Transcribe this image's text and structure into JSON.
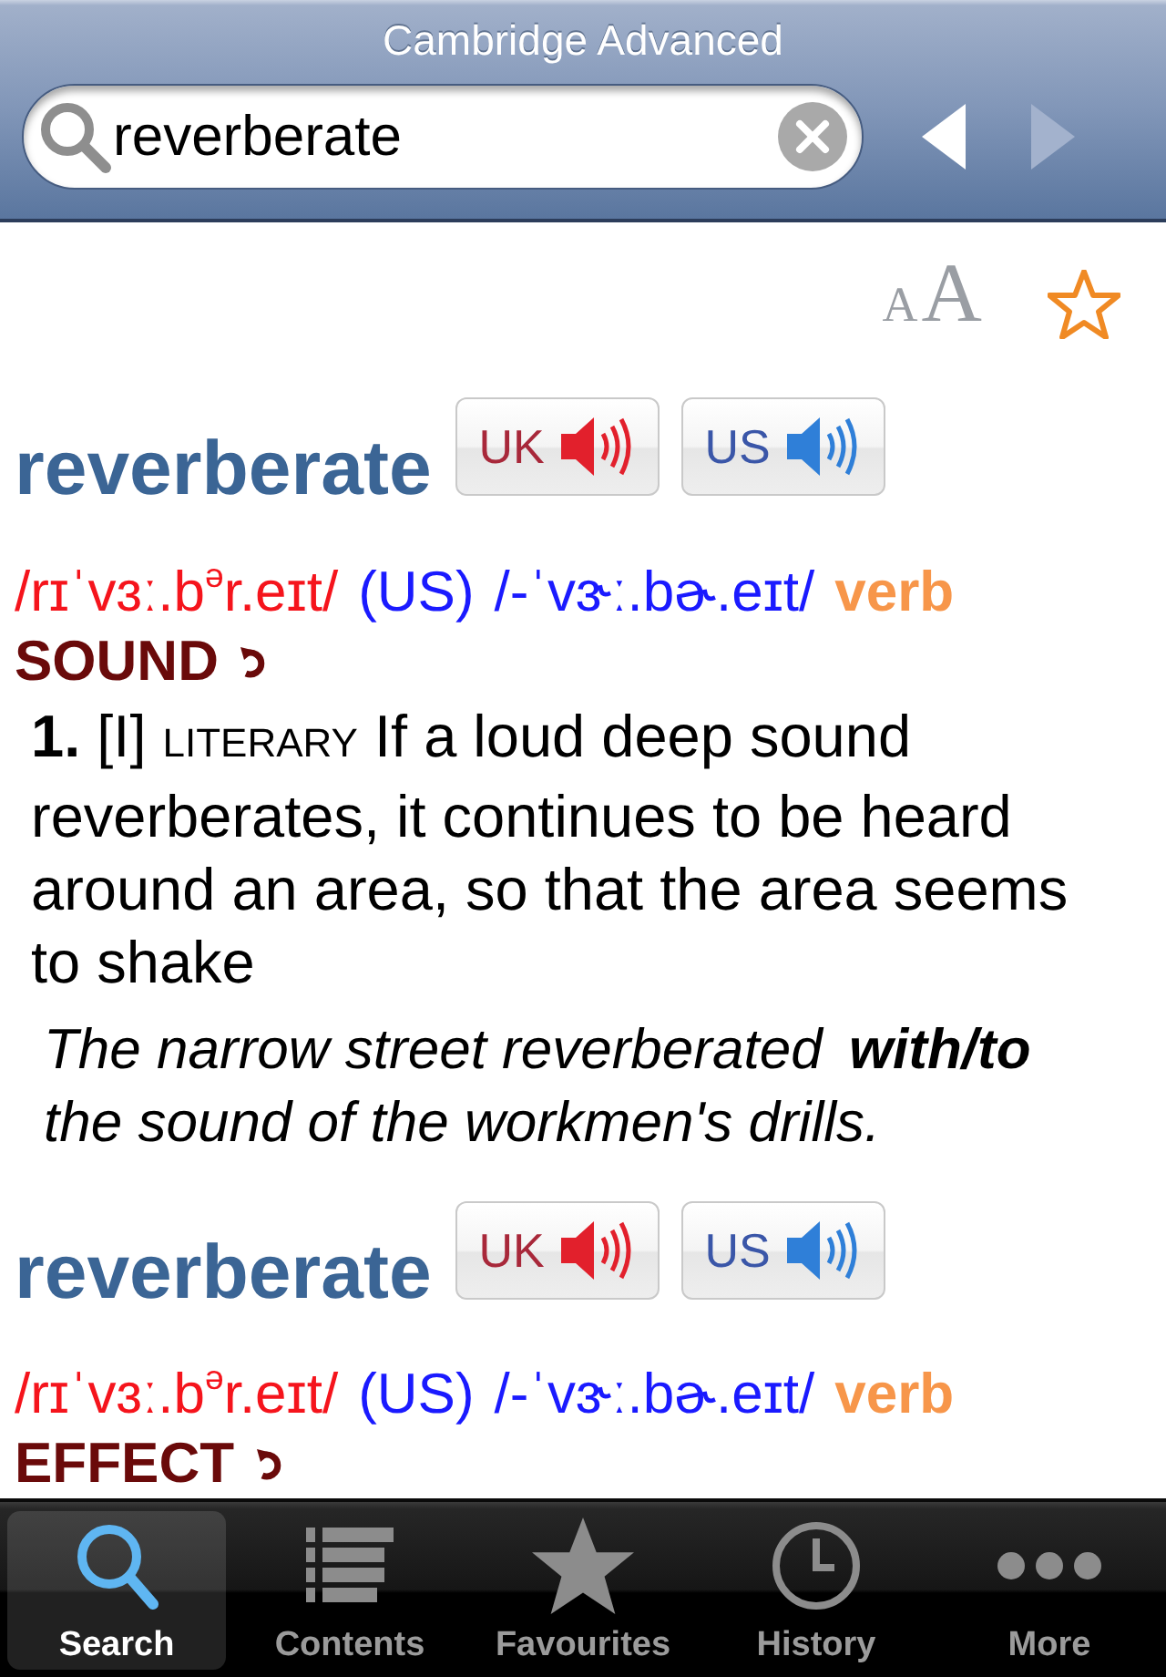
{
  "header": {
    "title": "Cambridge Advanced"
  },
  "search": {
    "value": "reverberate"
  },
  "nav": [
    {
      "kind": "back",
      "disabled": false
    },
    {
      "kind": "forward",
      "disabled": true
    }
  ],
  "toolbar": {
    "text_size": [
      "A",
      "A"
    ],
    "starred": false
  },
  "entries": [
    {
      "headword": "reverberate",
      "audio": [
        {
          "kind": "uk",
          "label": "UK"
        },
        {
          "kind": "us",
          "label": "US"
        }
      ],
      "pron_uk": "/rɪˈvɜː.b$^{ə}$r.eɪt/",
      "region": "(US)",
      "pron_us": "/-ˈvɝː.bɚ.eɪt/",
      "pos": "verb",
      "guide": "SOUND",
      "senses": [
        {
          "number": "1.",
          "grammar": "[I]",
          "register": "LITERARY",
          "definition": "If a loud deep sound reverberates, it continues to be heard around an area, so that the area seems to shake",
          "examples": [
            "The narrow street reverberated **with/to** the sound of the workmen's drills."
          ]
        }
      ]
    },
    {
      "headword": "reverberate",
      "audio": [
        {
          "kind": "uk",
          "label": "UK"
        },
        {
          "kind": "us",
          "label": "US"
        }
      ],
      "pron_uk": "/rɪˈvɜː.b$^{ə}$r.eɪt/",
      "region": "(US)",
      "pron_us": "/-ˈvɝː.bɚ.eɪt/",
      "pos": "verb",
      "guide": "EFFECT"
    }
  ],
  "tabs": [
    {
      "kind": "search",
      "label": "Search",
      "selected": true
    },
    {
      "kind": "contents",
      "label": "Contents",
      "selected": false
    },
    {
      "kind": "favourites",
      "label": "Favourites",
      "selected": false
    },
    {
      "kind": "history",
      "label": "History",
      "selected": false
    },
    {
      "kind": "more",
      "label": "More",
      "selected": false
    }
  ]
}
